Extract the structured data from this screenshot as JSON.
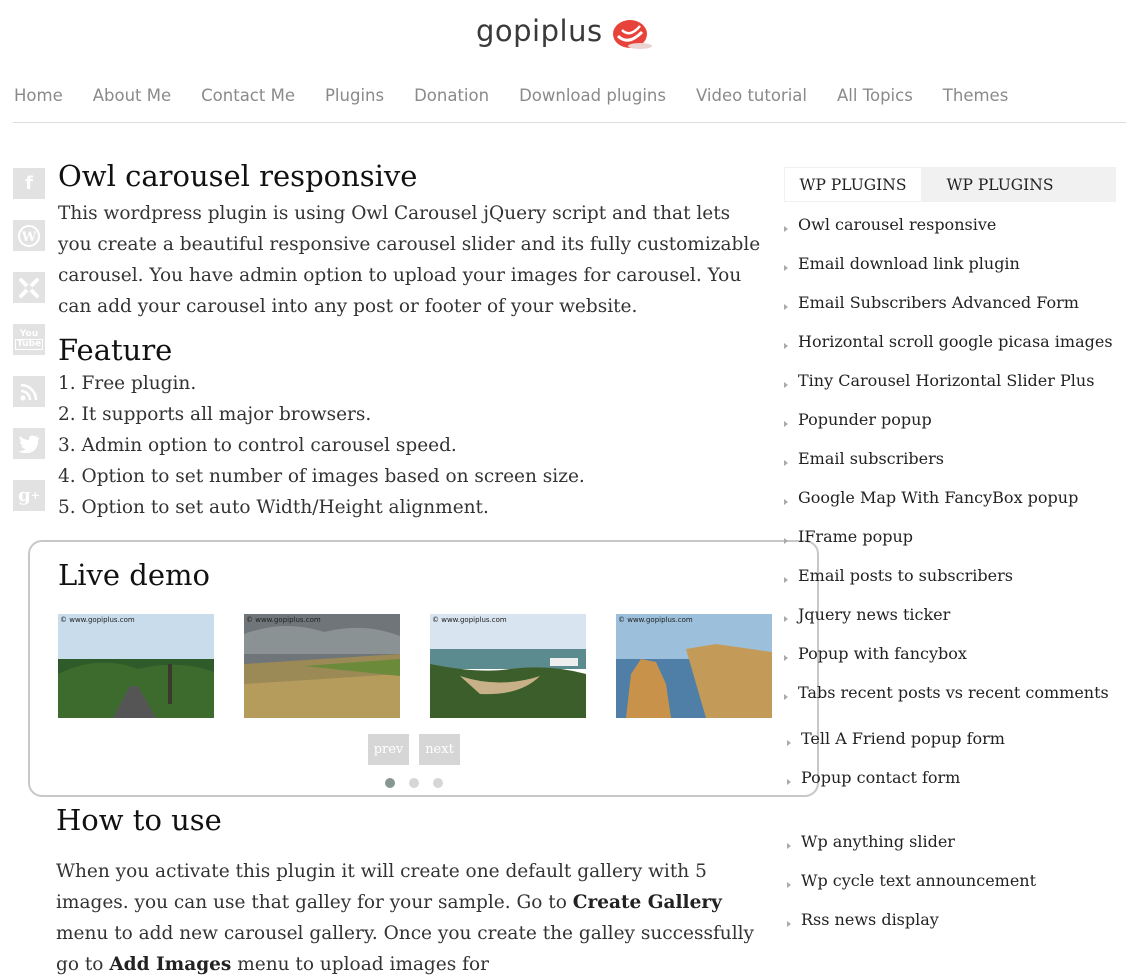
{
  "site": {
    "logo_text": "gopiplus"
  },
  "nav": [
    "Home",
    "About Me",
    "Contact Me",
    "Plugins",
    "Donation",
    "Download plugins",
    "Video tutorial",
    "All Topics",
    "Themes"
  ],
  "social_icons": [
    "facebook-icon",
    "wordpress-icon",
    "joomla-icon",
    "youtube-icon",
    "rss-icon",
    "twitter-icon",
    "google-plus-icon"
  ],
  "article": {
    "title": "Owl carousel responsive",
    "intro": "This wordpress plugin is using Owl Carousel jQuery script and that lets you create a beautiful responsive carousel slider and its fully customizable carousel. You have admin option to upload your images for carousel. You can add your carousel into any post or footer of your website.",
    "feature_heading": "Feature",
    "features": [
      "1. Free plugin.",
      "2. It supports all major browsers.",
      "3. Admin option to control carousel speed.",
      "4. Option to set number of images based on screen size.",
      "5. Option to set auto Width/Height alignment."
    ]
  },
  "demo": {
    "heading": "Live demo",
    "watermark": "© www.gopiplus.com",
    "prev_label": "prev",
    "next_label": "next",
    "dots": 3,
    "active_dot": 0
  },
  "howto": {
    "heading": "How to use",
    "p1": "When you activate this plugin it will create one default gallery with 5 images. you can use that galley for your sample. Go to ",
    "b1": "Create Gallery",
    "p2": " menu to add new carousel gallery. Once you create the galley successfully go to ",
    "b2": "Add Images",
    "p3": " menu to upload images for"
  },
  "sidebar": {
    "tabs": [
      "WP PLUGINS",
      "WP PLUGINS"
    ],
    "items": [
      "Owl carousel responsive",
      "Email download link plugin",
      "Email Subscribers Advanced Form",
      "Horizontal scroll google picasa images",
      "Tiny Carousel Horizontal Slider Plus",
      "Popunder popup",
      "Email subscribers",
      "Google Map With FancyBox popup",
      "IFrame popup",
      "Email posts to subscribers",
      "Jquery news ticker",
      "Popup with fancybox",
      "Tabs recent posts vs recent comments",
      "Tell A Friend popup form",
      "Popup contact form",
      "Wp anything slider",
      "Wp cycle text announcement",
      "Rss news display"
    ]
  }
}
